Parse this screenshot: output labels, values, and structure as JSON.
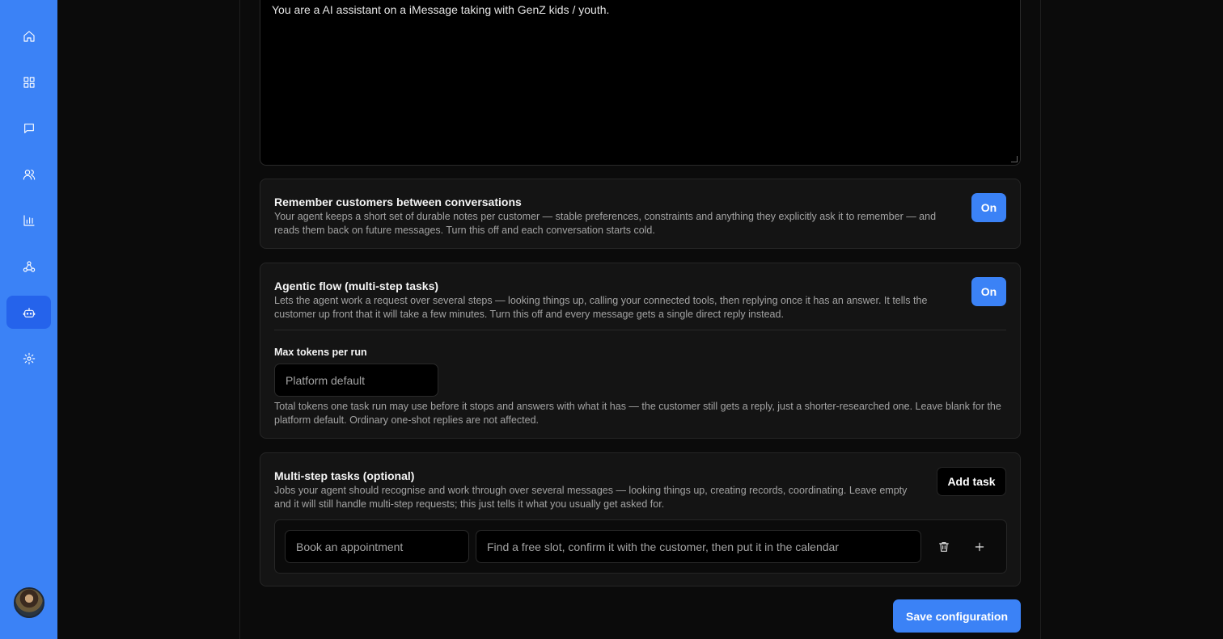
{
  "sidebar": {
    "items": [
      {
        "icon": "home-icon"
      },
      {
        "icon": "dashboard-icon"
      },
      {
        "icon": "chat-icon"
      },
      {
        "icon": "users-icon"
      },
      {
        "icon": "analytics-icon"
      },
      {
        "icon": "webhook-icon"
      },
      {
        "icon": "bot-icon",
        "active": true
      },
      {
        "icon": "settings-icon"
      }
    ],
    "accent": "#3b82f6"
  },
  "prompt": {
    "text": "You are a AI assistant on a iMessage taking with GenZ kids / youth."
  },
  "memory": {
    "title": "Remember customers between conversations",
    "description": "Your agent keeps a short set of durable notes per customer — stable preferences, constraints and anything they explicitly ask it to remember — and reads them back on future messages. Turn this off and each conversation starts cold.",
    "toggle_label": "On"
  },
  "agentic": {
    "title": "Agentic flow (multi-step tasks)",
    "description": "Lets the agent work a request over several steps — looking things up, calling your connected tools, then replying once it has an answer. It tells the customer up front that it will take a few minutes. Turn this off and every message gets a single direct reply instead.",
    "toggle_label": "On",
    "max_tokens_label": "Max tokens per run",
    "max_tokens_placeholder": "Platform default",
    "max_tokens_help": "Total tokens one task run may use before it stops and answers with what it has — the customer still gets a reply, just a shorter-researched one. Leave blank for the platform default. Ordinary one-shot replies are not affected."
  },
  "tasks": {
    "title": "Multi-step tasks (optional)",
    "description": "Jobs your agent should recognise and work through over several messages — looking things up, creating records, coordinating. Leave empty and it will still handle multi-step requests; this just tells it what you usually get asked for.",
    "add_label": "Add task",
    "rows": [
      {
        "name_placeholder": "Book an appointment",
        "steps_placeholder": "Find a free slot, confirm it with the customer, then put it in the calendar"
      }
    ]
  },
  "save_label": "Save configuration"
}
